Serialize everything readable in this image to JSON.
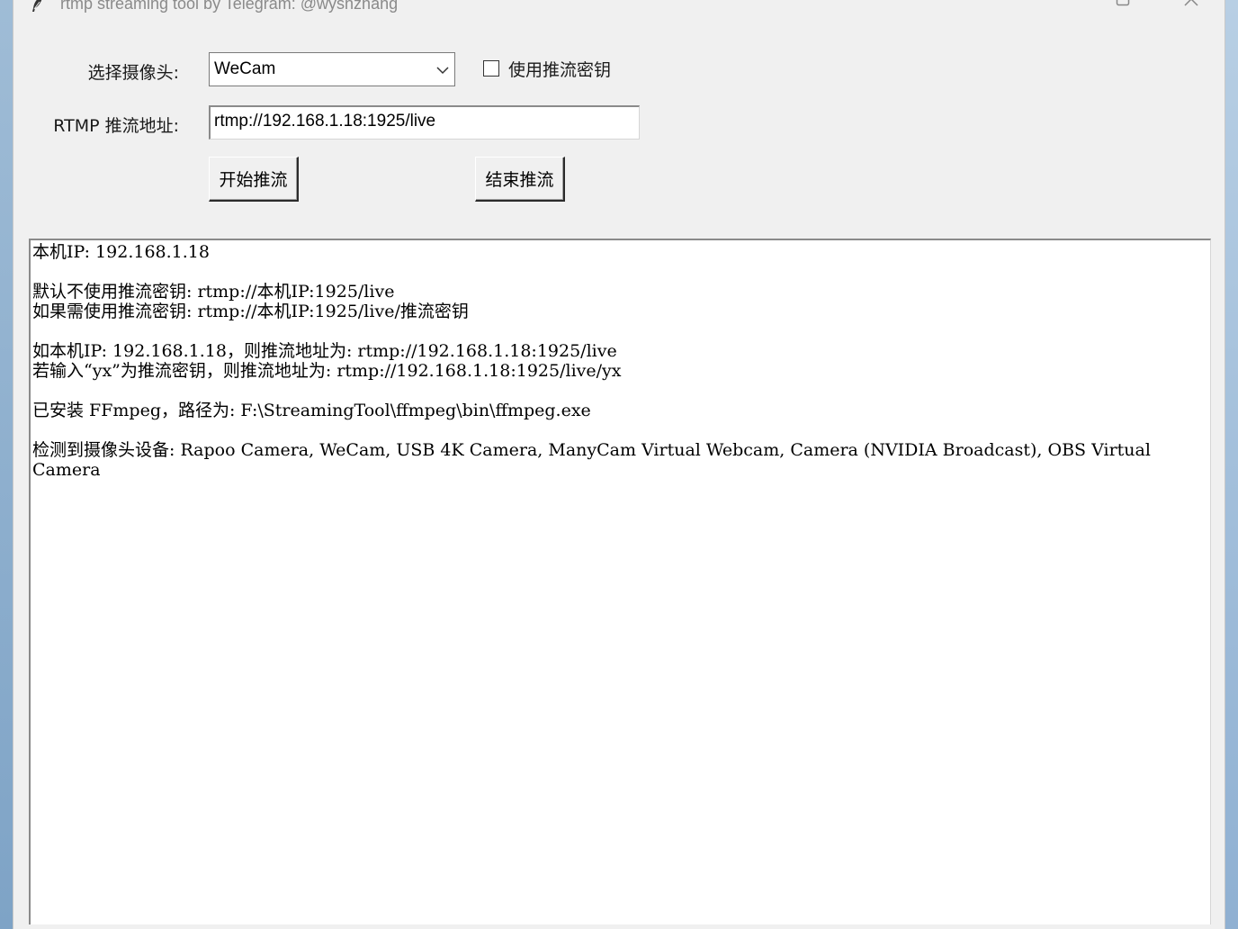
{
  "window": {
    "title": "rtmp streaming tool by Telegram: @wysnzhang",
    "controls": [
      "minimize",
      "maximize",
      "close"
    ]
  },
  "form": {
    "camera_label": "选择摄像头:",
    "camera_selected": "WeCam",
    "use_key_label": "使用推流密钥",
    "use_key_checked": false,
    "rtmp_label": "RTMP 推流地址:",
    "rtmp_url": "rtmp://192.168.1.18:1925/live",
    "start_button": "开始推流",
    "stop_button": "结束推流"
  },
  "log": {
    "lines": [
      "本机IP: 192.168.1.18",
      "",
      "默认不使用推流密钥: rtmp://本机IP:1925/live",
      "如果需使用推流密钥: rtmp://本机IP:1925/live/推流密钥",
      "",
      "如本机IP: 192.168.1.18，则推流地址为: rtmp://192.168.1.18:1925/live",
      "若输入“yx”为推流密钥，则推流地址为: rtmp://192.168.1.18:1925/live/yx",
      "",
      "已安装 FFmpeg，路径为: F:\\StreamingTool\\ffmpeg\\bin\\ffmpeg.exe",
      "",
      "检测到摄像头设备: Rapoo Camera, WeCam, USB 4K Camera, ManyCam Virtual Webcam, Camera (NVIDIA Broadcast), OBS Virtual Camera"
    ]
  },
  "icons": {
    "app": "feather-icon",
    "combo_arrow": "chevron-down-icon"
  }
}
